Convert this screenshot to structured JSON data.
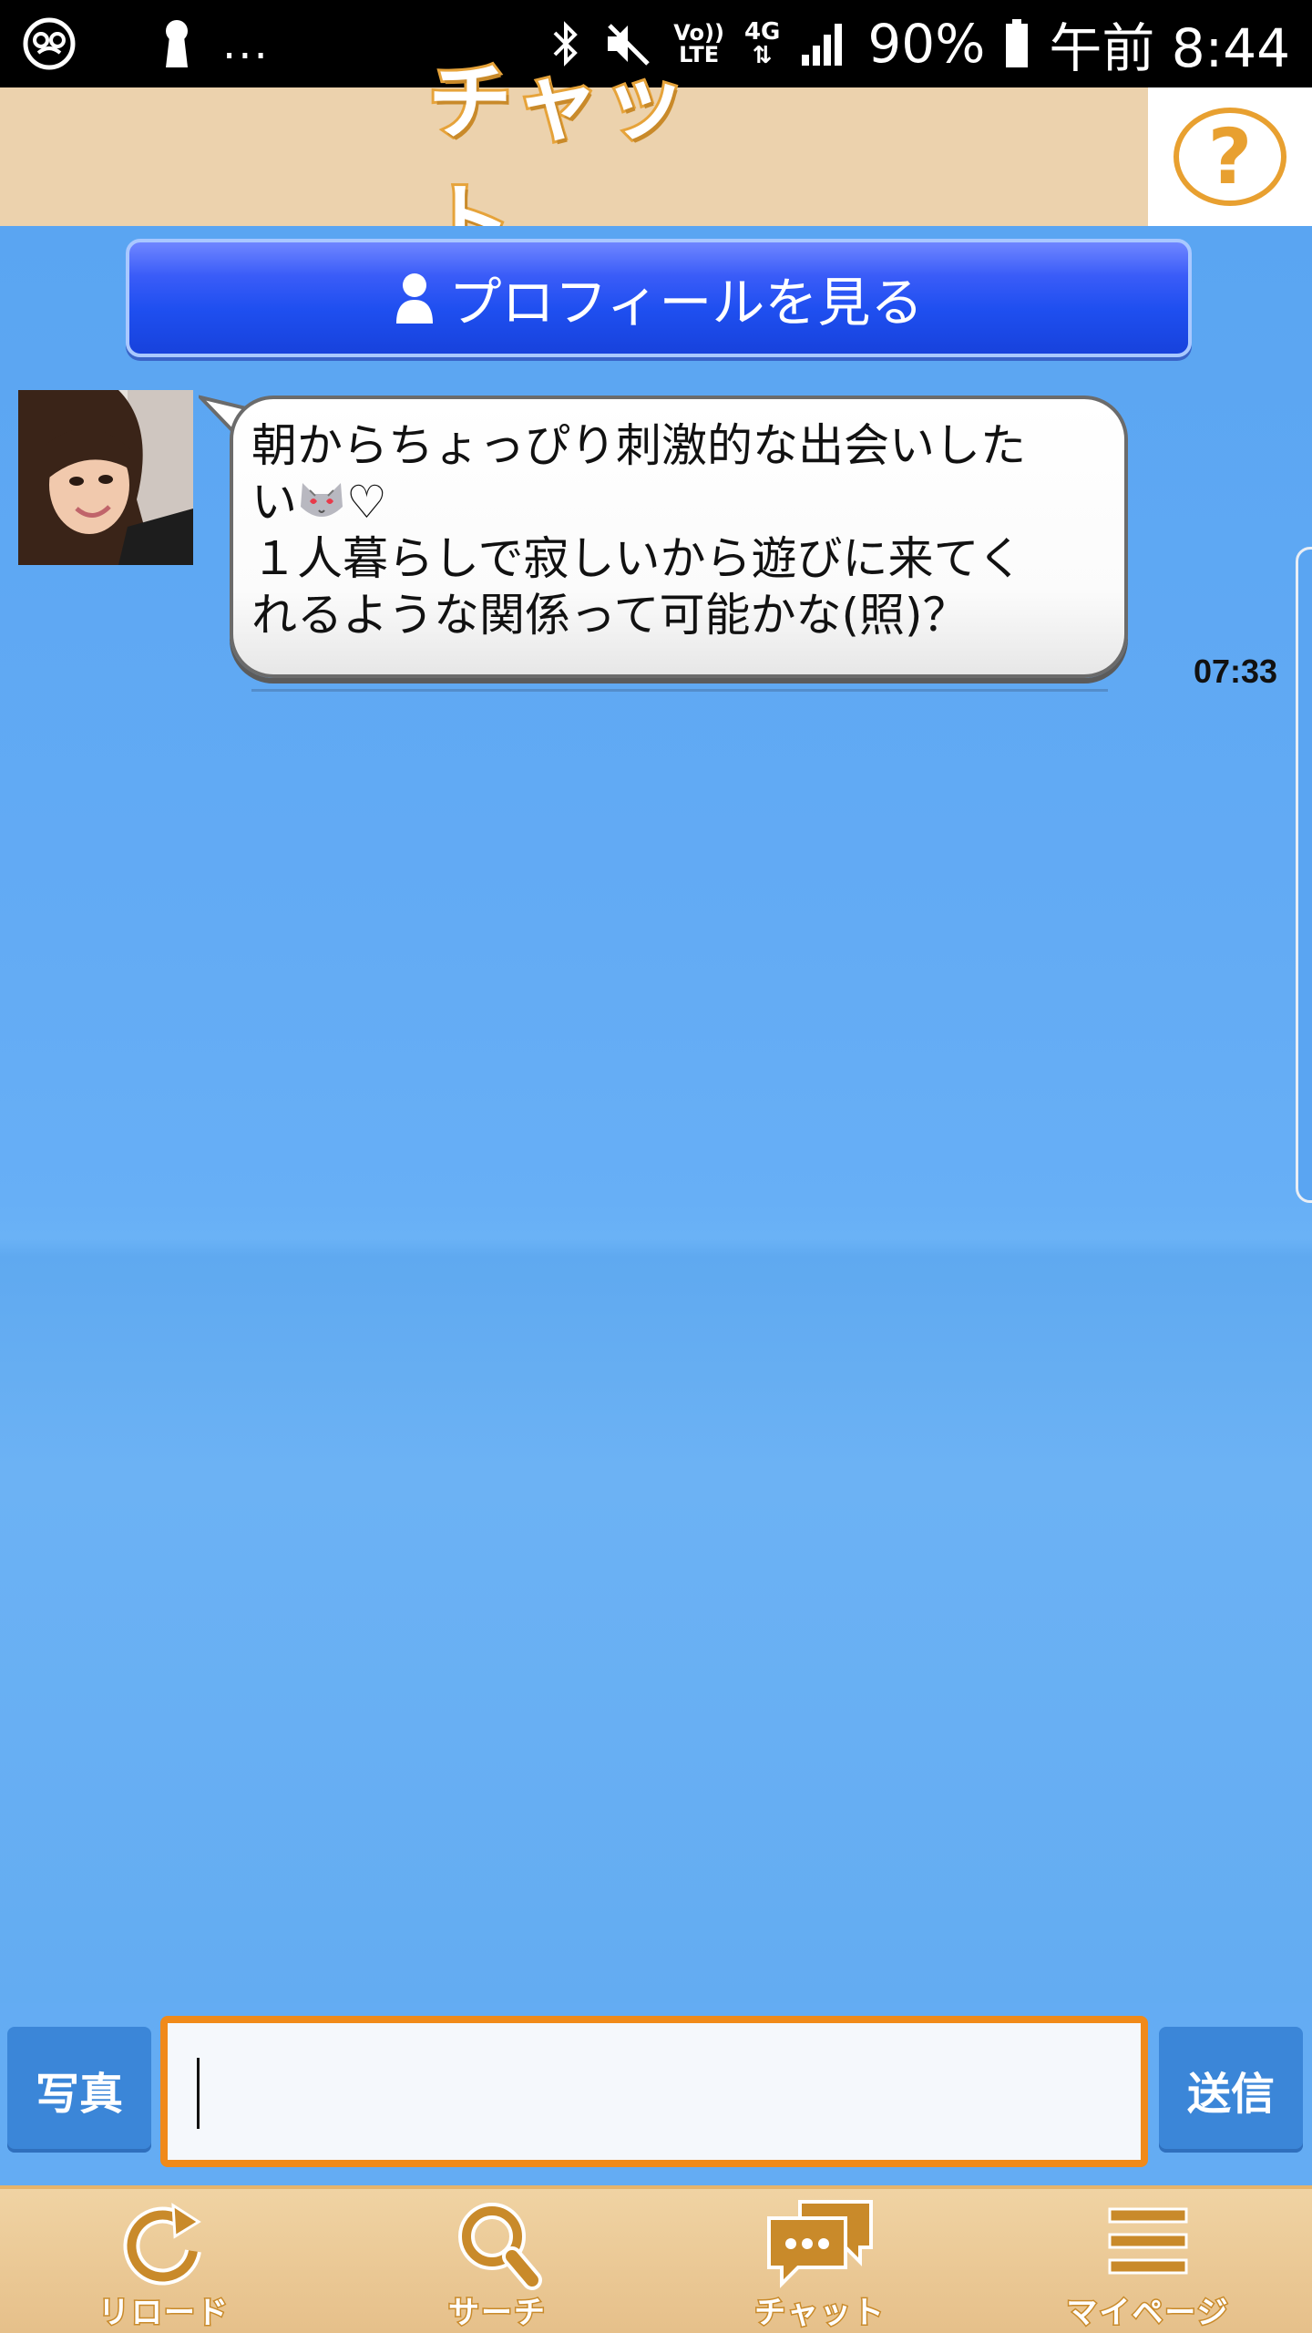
{
  "status_bar": {
    "dots": "...",
    "battery": "90%",
    "time": "午前 8:44",
    "volte_top": "Vo))",
    "volte_bottom": "LTE",
    "network": "4G"
  },
  "header": {
    "title": "チャット",
    "help_label": "?"
  },
  "chat": {
    "profile_button_label": "プロフィールを見る",
    "message": {
      "line1": "朝からちょっぴり刺激的な出会いした",
      "line2_prefix": "い",
      "line2_suffix": "♡",
      "line3": "１人暮らしで寂しいから遊びに来てく",
      "line4": "れるような関係って可能かな(照)？",
      "time": "07:33"
    }
  },
  "input_bar": {
    "photo_label": "写真",
    "send_label": "送信",
    "placeholder": ""
  },
  "nav": {
    "items": [
      {
        "label": "リロード",
        "icon": "reload-icon"
      },
      {
        "label": "サーチ",
        "icon": "search-icon"
      },
      {
        "label": "チャット",
        "icon": "chat-icon"
      },
      {
        "label": "マイページ",
        "icon": "menu-icon"
      }
    ]
  },
  "colors": {
    "header_bg": "#ecd2ad",
    "accent_orange": "#e8a030",
    "chat_bg": "#61a8f0",
    "profile_button": "#1f4ff0",
    "action_button": "#3b86d8",
    "input_border": "#f08a1a"
  }
}
